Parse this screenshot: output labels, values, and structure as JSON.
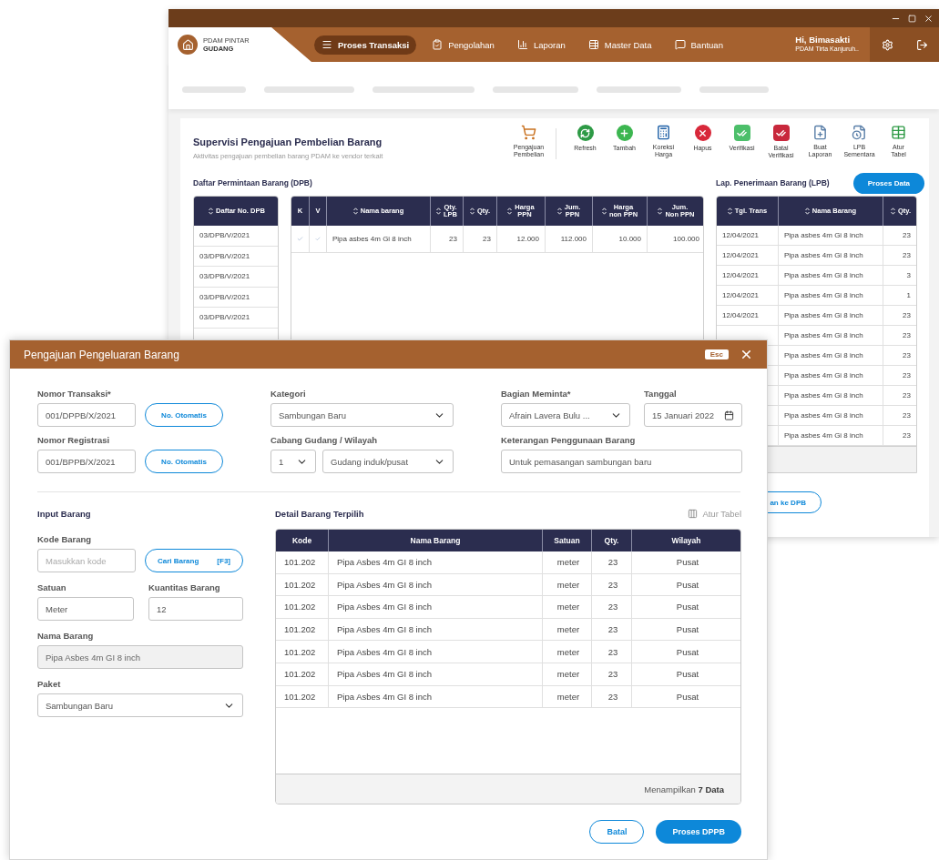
{
  "brand": {
    "name": "PDAM PINTAR",
    "product": "GUDANG"
  },
  "nav": [
    {
      "label": "Proses Transaksi",
      "selected": true
    },
    {
      "label": "Pengolahan",
      "selected": false
    },
    {
      "label": "Laporan",
      "selected": false
    },
    {
      "label": "Master Data",
      "selected": false
    },
    {
      "label": "Bantuan",
      "selected": false
    }
  ],
  "user": {
    "greeting": "Hi, Bimasakti",
    "org": "PDAM Tirta Kanjuruh.."
  },
  "page": {
    "title": "Supervisi Pengajuan Pembelian Barang",
    "subtitle": "Aktivitas pengajuan pembelian barang PDAM ke vendor terkait",
    "tool_groups": [
      [
        "Pengajuan Pembelian"
      ],
      [
        "Refresh",
        "Tambah",
        "Koreksi Harga",
        "Hapus",
        "Verifikasi",
        "Batal Verifikasi",
        "Buat Laporan",
        "LPB Sementara",
        "Atur Tabel"
      ]
    ]
  },
  "dpb": {
    "title": "Daftar Permintaan Barang (DPB)",
    "column": "Daftar No. DPB",
    "rows": [
      "03/DPB/V/2021",
      "03/DPB/V/2021",
      "03/DPB/V/2021",
      "03/DPB/V/2021",
      "03/DPB/V/2021"
    ]
  },
  "items_table": {
    "columns": [
      "K",
      "V",
      "Nama barang",
      "Qty.\nLPB",
      "Qty.",
      "Harga\nPPN",
      "Jum.\nPPN",
      "Harga\nnon PPN",
      "Jum.\nNon PPN"
    ],
    "rows": [
      {
        "k_checked": true,
        "v_checked": true,
        "cells": [
          "",
          "",
          "Pipa asbes 4m Gi 8 inch",
          "23",
          "23",
          "12.000",
          "112.000",
          "10.000",
          "100.000"
        ]
      }
    ]
  },
  "lpb": {
    "title": "Lap. Penerimaan Barang (LPB)",
    "button": "Proses Data",
    "columns": [
      "Tgl. Trans",
      "Nama Barang",
      "Qty."
    ],
    "rows": [
      {
        "date": "12/04/2021",
        "name": "Pipa asbes 4m Gi 8 inch",
        "qty": "23"
      },
      {
        "date": "12/04/2021",
        "name": "Pipa asbes 4m Gi 8 inch",
        "qty": "23"
      },
      {
        "date": "12/04/2021",
        "name": "Pipa asbes 4m Gi 8 inch",
        "qty": "3"
      },
      {
        "date": "12/04/2021",
        "name": "Pipa asbes 4m Gi 8 inch",
        "qty": "1"
      },
      {
        "date": "12/04/2021",
        "name": "Pipa asbes 4m Gi 8 inch",
        "qty": "23"
      },
      {
        "name": "Pipa asbes 4m Gi 8 inch",
        "qty": "23"
      },
      {
        "name": "Pipa asbes 4m Gi 8 inch",
        "qty": "23"
      },
      {
        "name": "Pipa asbes 4m Gi 8 inch",
        "qty": "23"
      },
      {
        "name": "Pipa asbes 4m Gi 8 inch",
        "qty": "23"
      },
      {
        "name": "Pipa asbes 4m Gi 8 inch",
        "qty": "23"
      },
      {
        "name": "Pipa asbes 4m Gi 8 inch",
        "qty": "23"
      }
    ],
    "return_button": "an ke DPB"
  },
  "modal": {
    "title": "Pengajuan Pengeluaran Barang",
    "esc": "Esc",
    "nomor_transaksi": {
      "label": "Nomor Transaksi*",
      "value": "001/DPPB/X/2021",
      "button": "No. Otomatis"
    },
    "kategori": {
      "label": "Kategori",
      "value": "Sambungan Baru"
    },
    "bagian": {
      "label": "Bagian Meminta*",
      "value": "Afrain Lavera Bulu ..."
    },
    "tanggal": {
      "label": "Tanggal",
      "value": "15 Januari 2022"
    },
    "nomor_registrasi": {
      "label": "Nomor Registrasi",
      "value": "001/BPPB/X/2021",
      "button": "No. Otomatis"
    },
    "cabang": {
      "label": "Cabang Gudang / Wilayah",
      "number": "1",
      "value": "Gudang induk/pusat"
    },
    "keterangan": {
      "label": "Keterangan Penggunaan Barang",
      "value": "Untuk pemasangan sambungan baru"
    },
    "input_section": {
      "title": "Input Barang",
      "kode": {
        "label": "Kode Barang",
        "placeholder": "Masukkan kode",
        "button": "Cari Barang",
        "shortcut": "[F3]"
      },
      "satuan": {
        "label": "Satuan",
        "value": "Meter"
      },
      "kuantitas": {
        "label": "Kuantitas Barang",
        "value": "12"
      },
      "nama": {
        "label": "Nama Barang",
        "value": "Pipa Asbes 4m GI 8 inch",
        "disabled": true
      },
      "paket": {
        "label": "Paket",
        "value": "Sambungan Baru"
      }
    },
    "detail": {
      "title": "Detail Barang Terpilih",
      "settings": "Atur Tabel",
      "columns": [
        "Kode",
        "Nama Barang",
        "Satuan",
        "Qty.",
        "Wilayah"
      ],
      "rows": [
        [
          "101.202",
          "Pipa Asbes 4m GI 8 inch",
          "meter",
          "23",
          "Pusat"
        ],
        [
          "101.202",
          "Pipa Asbes 4m GI 8 inch",
          "meter",
          "23",
          "Pusat"
        ],
        [
          "101.202",
          "Pipa Asbes 4m GI 8 inch",
          "meter",
          "23",
          "Pusat"
        ],
        [
          "101.202",
          "Pipa Asbes 4m GI 8 inch",
          "meter",
          "23",
          "Pusat"
        ],
        [
          "101.202",
          "Pipa Asbes 4m GI 8 inch",
          "meter",
          "23",
          "Pusat"
        ],
        [
          "101.202",
          "Pipa Asbes 4m GI 8 inch",
          "meter",
          "23",
          "Pusat"
        ],
        [
          "101.202",
          "Pipa Asbes 4m GI 8 inch",
          "meter",
          "23",
          "Pusat"
        ]
      ],
      "footer": "Menampilkan **7 Data**"
    },
    "buttons": {
      "cancel": "Batal",
      "submit": "Proses DPPB"
    }
  }
}
